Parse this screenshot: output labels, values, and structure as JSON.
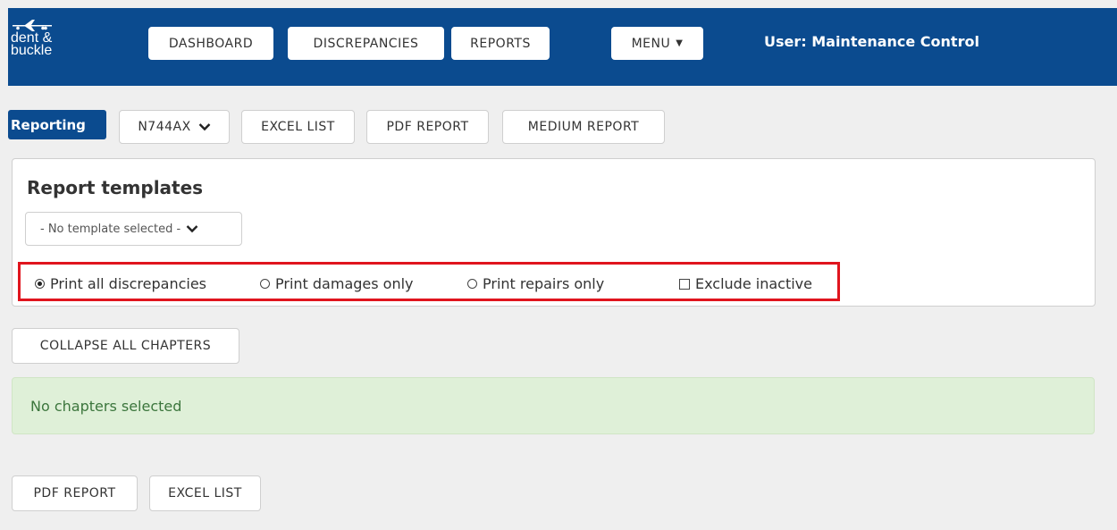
{
  "app": {
    "logo_line1": "dent &",
    "logo_line2": "buckle",
    "user": "User: Maintenance Control"
  },
  "nav": {
    "dashboard": "DASHBOARD",
    "discrepancies": "DISCREPANCIES",
    "reports": "REPORTS",
    "menu": "MENU"
  },
  "toolbar": {
    "badge": "Reporting",
    "aircraft": "N744AX",
    "excel_list": "EXCEL LIST",
    "pdf_report": "PDF REPORT",
    "medium_report": "MEDIUM REPORT"
  },
  "templates": {
    "title": "Report templates",
    "selected": "- No template selected -",
    "options": {
      "all": "Print all discrepancies",
      "damages": "Print damages only",
      "repairs": "Print repairs only",
      "exclude_inactive": "Exclude inactive"
    },
    "selected_option": "all",
    "exclude_inactive_checked": false
  },
  "chapters": {
    "collapse_all": "COLLAPSE ALL CHAPTERS",
    "empty_message": "No chapters selected"
  },
  "footer": {
    "pdf_report": "PDF REPORT",
    "excel_list": "EXCEL LIST"
  },
  "colors": {
    "brand": "#0b4b8f",
    "highlight": "#e0151e",
    "success_bg": "#dff0d8",
    "success_text": "#3c763d"
  }
}
